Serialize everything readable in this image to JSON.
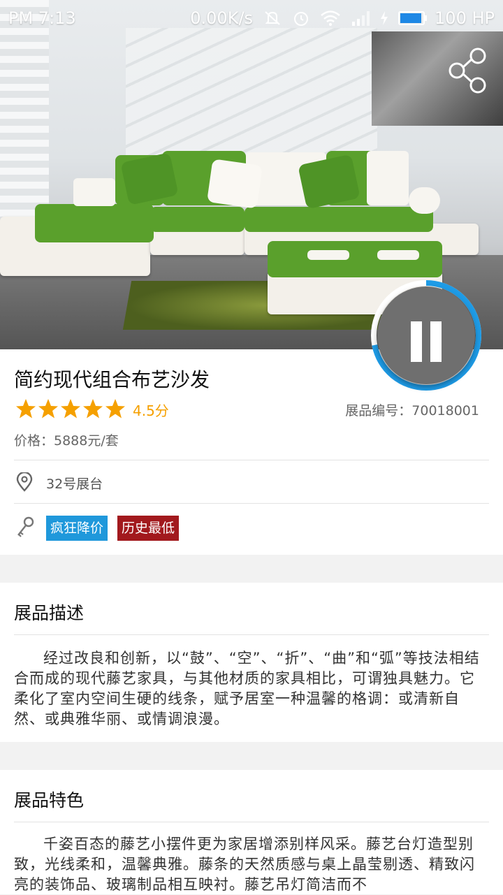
{
  "status_bar": {
    "time": "PM 7:13",
    "speed": "0.00K/s",
    "battery_label": "100 HP",
    "battery_level_percent": 100,
    "battery_color": "#1e88e5"
  },
  "product": {
    "title": "简约现代组合布艺沙发",
    "rating_text": "4.5分",
    "rating_stars": 5,
    "code_label": "展品编号：70018001",
    "price_label": "价格：5888元/套",
    "location": "32号展台",
    "tags": [
      {
        "label": "疯狂降价",
        "color": "#1f98db"
      },
      {
        "label": "历史最低",
        "color": "#a2191d"
      }
    ]
  },
  "player": {
    "state_icon": "pause-icon",
    "progress_fraction": 0.72,
    "ring_color": "#1e9be6"
  },
  "description": {
    "heading": "展品描述",
    "text": "经过改良和创新，以“鼓”、“空”、“折”、“曲”和“弧”等技法相结合而成的现代藤艺家具，与其他材质的家具相比，可谓独具魅力。它柔化了室内空间生硬的线条，赋予居室一种温馨的格调：或清新自然、或典雅华丽、或情调浪漫。"
  },
  "features": {
    "heading": "展品特色",
    "text": "千姿百态的藤艺小摆件更为家居增添别样风采。藤艺台灯造型别致，光线柔和，温馨典雅。藤条的天然质感与桌上晶莹剔透、精致闪亮的装饰品、玻璃制品相互映衬。藤艺吊灯简洁而不"
  },
  "colors": {
    "accent_orange": "#f5a000",
    "divider": "#e3e3e3"
  }
}
